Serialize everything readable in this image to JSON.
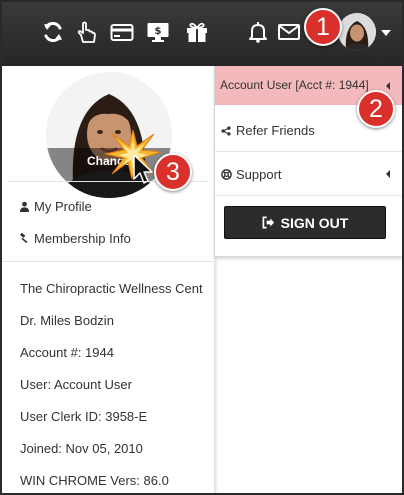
{
  "topbar": {
    "icons": [
      "refresh-icon",
      "touch-hand-icon",
      "credit-card-icon",
      "desktop-dollar-icon",
      "gift-icon",
      "bell-icon",
      "mail-icon"
    ],
    "background": "#2f2f2f"
  },
  "callouts": {
    "one": "1",
    "two": "2",
    "three": "3",
    "color": "#d9302c"
  },
  "profile": {
    "change_label": "Change",
    "my_profile": "My Profile",
    "membership_info": "Membership Info"
  },
  "account_info": [
    "The Chiropractic Wellness Cent",
    "Dr. Miles Bodzin",
    "Account #: 1944",
    "User: Account User",
    "User Clerk ID: 3958-E",
    "Joined: Nov 05, 2010",
    "WIN CHROME Vers: 86.0"
  ],
  "account_menu": {
    "account_label": "Account User [Acct #: 1944]",
    "refer_friends": "Refer Friends",
    "support": "Support",
    "sign_out": "SIGN OUT",
    "highlight_color": "#f4b9bd"
  }
}
